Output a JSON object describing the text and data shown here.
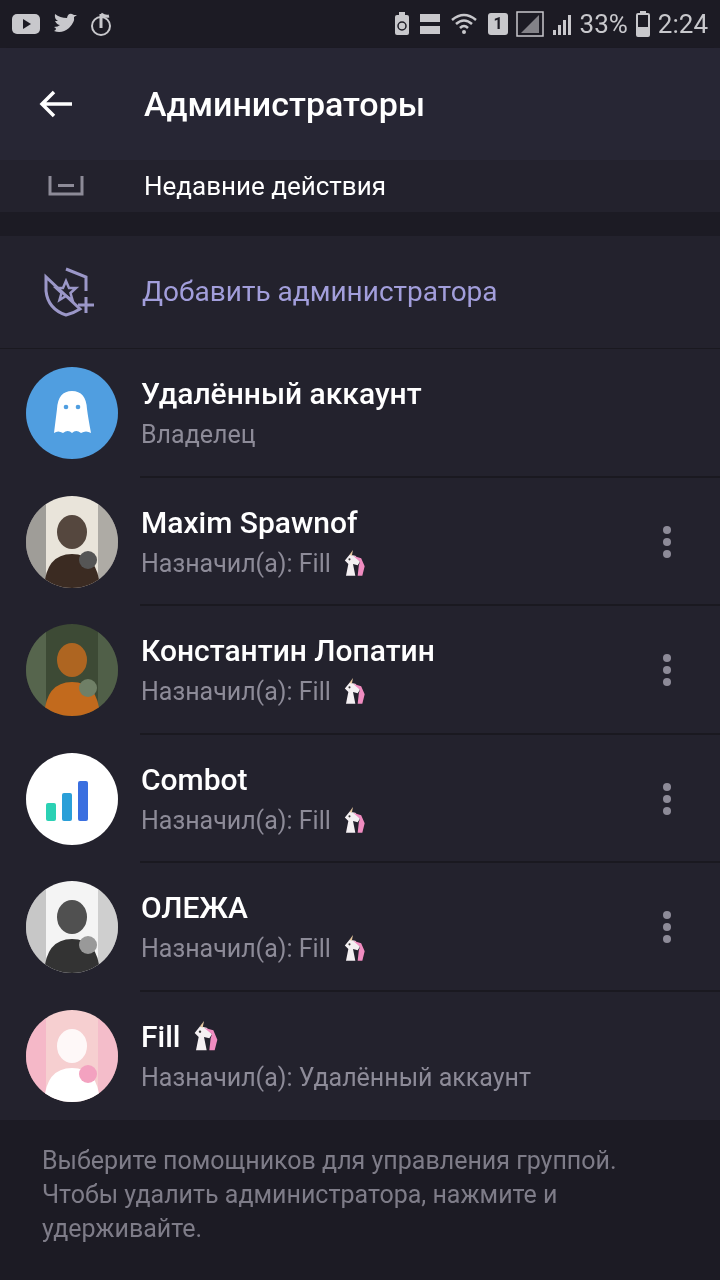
{
  "status_bar": {
    "battery": "33%",
    "time": "2:24",
    "sim": "1"
  },
  "header": {
    "title": "Администраторы"
  },
  "recent_actions": {
    "label": "Недавние действия"
  },
  "add_admin": {
    "label": "Добавить администратора"
  },
  "admins": [
    {
      "name": "Удалённый аккаунт",
      "name_unicorn": false,
      "subtitle": "Владелец",
      "subtitle_unicorn": false,
      "kind": "ghost",
      "menu": false
    },
    {
      "name": "Maxim Spawnof",
      "name_unicorn": false,
      "subtitle": "Назначил(а): Fill",
      "subtitle_unicorn": true,
      "kind": "picture",
      "menu": true
    },
    {
      "name": "Константин Лопатин",
      "name_unicorn": false,
      "subtitle": "Назначил(а): Fill",
      "subtitle_unicorn": true,
      "kind": "picture",
      "menu": true
    },
    {
      "name": "Combot",
      "name_unicorn": false,
      "subtitle": "Назначил(а): Fill",
      "subtitle_unicorn": true,
      "kind": "bars",
      "menu": true
    },
    {
      "name": "ОЛЕЖА",
      "name_unicorn": false,
      "subtitle": "Назначил(а): Fill",
      "subtitle_unicorn": true,
      "kind": "picture",
      "menu": true
    },
    {
      "name": "Fill",
      "name_unicorn": true,
      "subtitle": "Назначил(а): Удалённый аккаунт",
      "subtitle_unicorn": false,
      "kind": "picture",
      "menu": false
    }
  ],
  "hint": "Выберите помощников для управления группой. Чтобы удалить администратора, нажмите и удерживайте."
}
